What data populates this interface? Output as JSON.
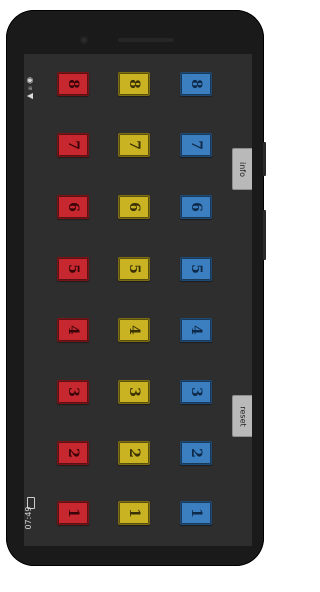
{
  "status": {
    "time": "07:49",
    "icons": "▲ ᵢₗₗ ◉"
  },
  "buttons": {
    "info_label": "info",
    "reset_label": "reset"
  },
  "colors": {
    "red": "#c7282f",
    "yellow": "#c9b322",
    "blue": "#3b7fc0",
    "background": "#2e2e2e"
  },
  "rows": [
    {
      "red": "8",
      "yellow": "8",
      "blue": "8"
    },
    {
      "red": "7",
      "yellow": "7",
      "blue": "7"
    },
    {
      "red": "6",
      "yellow": "6",
      "blue": "6"
    },
    {
      "red": "5",
      "yellow": "5",
      "blue": "5"
    },
    {
      "red": "4",
      "yellow": "4",
      "blue": "4"
    },
    {
      "red": "3",
      "yellow": "3",
      "blue": "3"
    },
    {
      "red": "2",
      "yellow": "2",
      "blue": "2"
    },
    {
      "red": "1",
      "yellow": "1",
      "blue": "1"
    }
  ]
}
